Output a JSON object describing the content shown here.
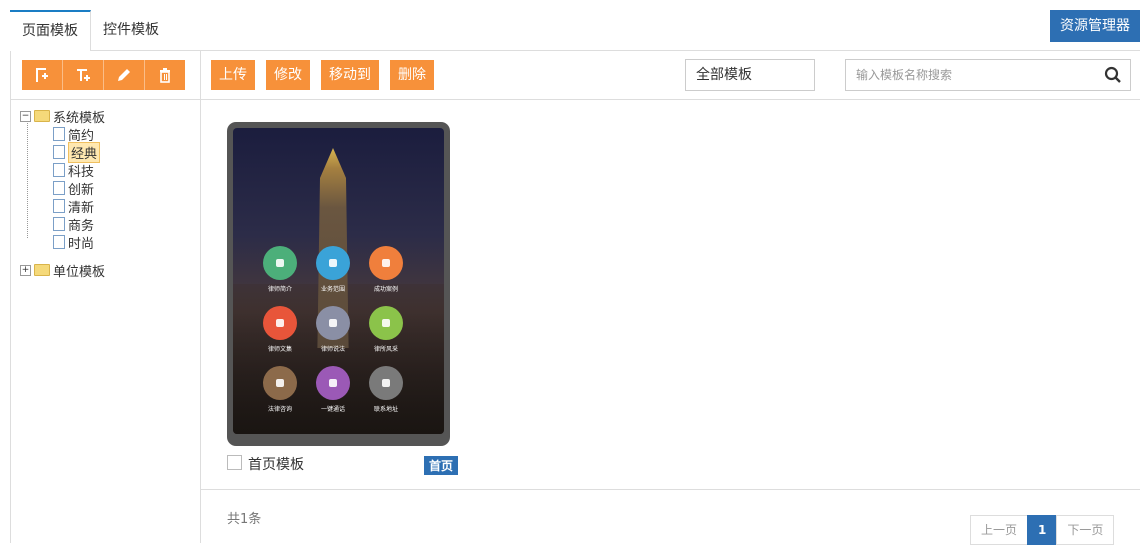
{
  "tabs": [
    {
      "label": "页面模板",
      "active": true
    },
    {
      "label": "控件模板",
      "active": false
    }
  ],
  "resource_manager_label": "资源管理器",
  "left_toolbar_icons": [
    "add-page-icon",
    "add-child-icon",
    "edit-icon",
    "delete-icon"
  ],
  "tree": {
    "root": {
      "label": "系统模板",
      "expanded": true,
      "children": [
        "简约",
        "经典",
        "科技",
        "创新",
        "清新",
        "商务",
        "时尚"
      ],
      "selected": "经典"
    },
    "second": {
      "label": "单位模板",
      "expanded": false
    }
  },
  "actions": [
    "上传",
    "修改",
    "移动到",
    "删除"
  ],
  "filter_select": "全部模板",
  "search": {
    "placeholder": "输入模板名称搜索"
  },
  "card": {
    "name": "首页模板",
    "badge": "首页",
    "apps": [
      {
        "label": "律师简介",
        "color": "#4caf7a"
      },
      {
        "label": "业务范围",
        "color": "#3aa3d8"
      },
      {
        "label": "成功案例",
        "color": "#f07f3c"
      },
      {
        "label": "律师文集",
        "color": "#e8553a"
      },
      {
        "label": "律师说法",
        "color": "#8a8fa5"
      },
      {
        "label": "律所风采",
        "color": "#8bc34a"
      },
      {
        "label": "法律咨询",
        "color": "#8c6a4a"
      },
      {
        "label": "一键通话",
        "color": "#9b59b6"
      },
      {
        "label": "联系地址",
        "color": "#7a7a7a"
      }
    ]
  },
  "total_label": "共1条",
  "pager": {
    "prev": "上一页",
    "current": "1",
    "next": "下一页"
  },
  "colors": {
    "accent_orange": "#f7913a",
    "primary_blue": "#2d6fb3"
  }
}
